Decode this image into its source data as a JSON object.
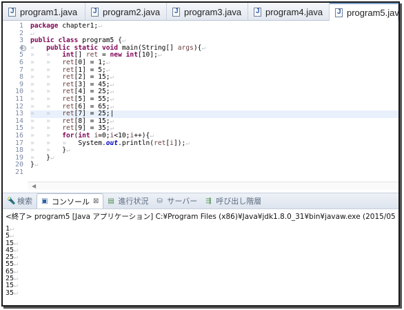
{
  "editor_tabs": [
    {
      "label": "program1.java",
      "active": false
    },
    {
      "label": "program2.java",
      "active": false
    },
    {
      "label": "program3.java",
      "active": false
    },
    {
      "label": "program4.java",
      "active": false
    },
    {
      "label": "program5.jav",
      "active": true
    }
  ],
  "line_numbers": [
    "1",
    "2",
    "3",
    "4",
    "5",
    "6",
    "7",
    "8",
    "9",
    "10",
    "11",
    "12",
    "13",
    "14",
    "15",
    "16",
    "17",
    "18",
    "19",
    "20",
    "21"
  ],
  "code_lines": [
    [
      {
        "c": "kw",
        "t": "package"
      },
      {
        "c": "",
        "t": " chapter1;"
      },
      {
        "c": "ws",
        "t": "↵"
      }
    ],
    [
      {
        "c": "ws",
        "t": "↵"
      }
    ],
    [
      {
        "c": "kw",
        "t": "public"
      },
      {
        "c": "",
        "t": " "
      },
      {
        "c": "kw",
        "t": "class"
      },
      {
        "c": "",
        "t": " program5 {"
      },
      {
        "c": "ws",
        "t": "↵"
      }
    ],
    [
      {
        "c": "ws",
        "t": "»   "
      },
      {
        "c": "kw",
        "t": "public"
      },
      {
        "c": "",
        "t": " "
      },
      {
        "c": "kw",
        "t": "static"
      },
      {
        "c": "",
        "t": " "
      },
      {
        "c": "kw",
        "t": "void"
      },
      {
        "c": "",
        "t": " main(String[] "
      },
      {
        "c": "var",
        "t": "args"
      },
      {
        "c": "",
        "t": "){"
      },
      {
        "c": "ws",
        "t": "↵"
      }
    ],
    [
      {
        "c": "ws",
        "t": "»   »   "
      },
      {
        "c": "kw",
        "t": "int"
      },
      {
        "c": "",
        "t": "[] "
      },
      {
        "c": "var",
        "t": "ret"
      },
      {
        "c": "",
        "t": " = "
      },
      {
        "c": "kw",
        "t": "new"
      },
      {
        "c": "",
        "t": " "
      },
      {
        "c": "kw",
        "t": "int"
      },
      {
        "c": "",
        "t": "[10];"
      },
      {
        "c": "ws",
        "t": "↵"
      }
    ],
    [
      {
        "c": "ws",
        "t": "»   »   "
      },
      {
        "c": "var",
        "t": "ret"
      },
      {
        "c": "",
        "t": "[0] = 1;"
      },
      {
        "c": "ws",
        "t": "↵"
      }
    ],
    [
      {
        "c": "ws",
        "t": "»   »   "
      },
      {
        "c": "var",
        "t": "ret"
      },
      {
        "c": "",
        "t": "[1] = 5;"
      },
      {
        "c": "ws",
        "t": "↵"
      }
    ],
    [
      {
        "c": "ws",
        "t": "»   »   "
      },
      {
        "c": "var",
        "t": "ret"
      },
      {
        "c": "",
        "t": "[2] = 15;"
      },
      {
        "c": "ws",
        "t": "↵"
      }
    ],
    [
      {
        "c": "ws",
        "t": "»   »   "
      },
      {
        "c": "var",
        "t": "ret"
      },
      {
        "c": "",
        "t": "[3] = 45;"
      },
      {
        "c": "ws",
        "t": "↵"
      }
    ],
    [
      {
        "c": "ws",
        "t": "»   »   "
      },
      {
        "c": "var",
        "t": "ret"
      },
      {
        "c": "",
        "t": "[4] = 25;"
      },
      {
        "c": "ws",
        "t": "↵"
      }
    ],
    [
      {
        "c": "ws",
        "t": "»   »   "
      },
      {
        "c": "var",
        "t": "ret"
      },
      {
        "c": "",
        "t": "[5] = 55;"
      },
      {
        "c": "ws",
        "t": "↵"
      }
    ],
    [
      {
        "c": "ws",
        "t": "»   »   "
      },
      {
        "c": "var",
        "t": "ret"
      },
      {
        "c": "",
        "t": "[6] = 65;"
      },
      {
        "c": "ws",
        "t": "↵"
      }
    ],
    [
      {
        "c": "ws",
        "t": "»   »   "
      },
      {
        "c": "var",
        "t": "ret"
      },
      {
        "c": "",
        "t": "[7] = 25;|"
      }
    ],
    [
      {
        "c": "ws",
        "t": "»   »   "
      },
      {
        "c": "var",
        "t": "ret"
      },
      {
        "c": "",
        "t": "[8] = 15;"
      },
      {
        "c": "ws",
        "t": "↵"
      }
    ],
    [
      {
        "c": "ws",
        "t": "»   »   "
      },
      {
        "c": "var",
        "t": "ret"
      },
      {
        "c": "",
        "t": "[9] = 35;"
      },
      {
        "c": "ws",
        "t": "↵"
      }
    ],
    [
      {
        "c": "ws",
        "t": "»   »   "
      },
      {
        "c": "kw",
        "t": "for"
      },
      {
        "c": "",
        "t": "("
      },
      {
        "c": "kw",
        "t": "int"
      },
      {
        "c": "",
        "t": " "
      },
      {
        "c": "var",
        "t": "i"
      },
      {
        "c": "",
        "t": "=0;"
      },
      {
        "c": "var",
        "t": "i"
      },
      {
        "c": "",
        "t": "<10;"
      },
      {
        "c": "var",
        "t": "i"
      },
      {
        "c": "",
        "t": "++){"
      },
      {
        "c": "ws",
        "t": "↵"
      }
    ],
    [
      {
        "c": "ws",
        "t": "»   »   »   "
      },
      {
        "c": "",
        "t": "System."
      },
      {
        "c": "fld",
        "t": "out"
      },
      {
        "c": "",
        "t": ".println("
      },
      {
        "c": "var",
        "t": "ret"
      },
      {
        "c": "",
        "t": "["
      },
      {
        "c": "var",
        "t": "i"
      },
      {
        "c": "",
        "t": "]);"
      },
      {
        "c": "ws",
        "t": "↵"
      }
    ],
    [
      {
        "c": "ws",
        "t": "»   »   "
      },
      {
        "c": "",
        "t": "}"
      },
      {
        "c": "ws",
        "t": "↵"
      }
    ],
    [
      {
        "c": "ws",
        "t": "»   "
      },
      {
        "c": "",
        "t": "}"
      },
      {
        "c": "ws",
        "t": "↵"
      }
    ],
    [
      {
        "c": "",
        "t": "}"
      },
      {
        "c": "ws",
        "t": "↵"
      }
    ],
    []
  ],
  "current_line": 13,
  "view_tabs": [
    {
      "label": "検索",
      "icon": "search-icon",
      "active": false
    },
    {
      "label": "コンソール",
      "icon": "console-icon",
      "active": true
    },
    {
      "label": "進行状況",
      "icon": "progress-icon",
      "active": false
    },
    {
      "label": "サーバー",
      "icon": "servers-icon",
      "active": false
    },
    {
      "label": "呼び出し階層",
      "icon": "call-hierarchy-icon",
      "active": false
    }
  ],
  "console": {
    "status": "<終了> program5 [Java アプリケーション] C:¥Program Files (x86)¥Java¥jdk1.8.0_31¥bin¥javaw.exe (2015/05",
    "output": [
      "1",
      "5",
      "15",
      "45",
      "25",
      "55",
      "65",
      "25",
      "15",
      "35"
    ]
  },
  "colors": {
    "keyword": "#7f0055",
    "variable": "#6a3e3e",
    "field": "#0000c0",
    "gutter_marker": "#ffffff"
  }
}
